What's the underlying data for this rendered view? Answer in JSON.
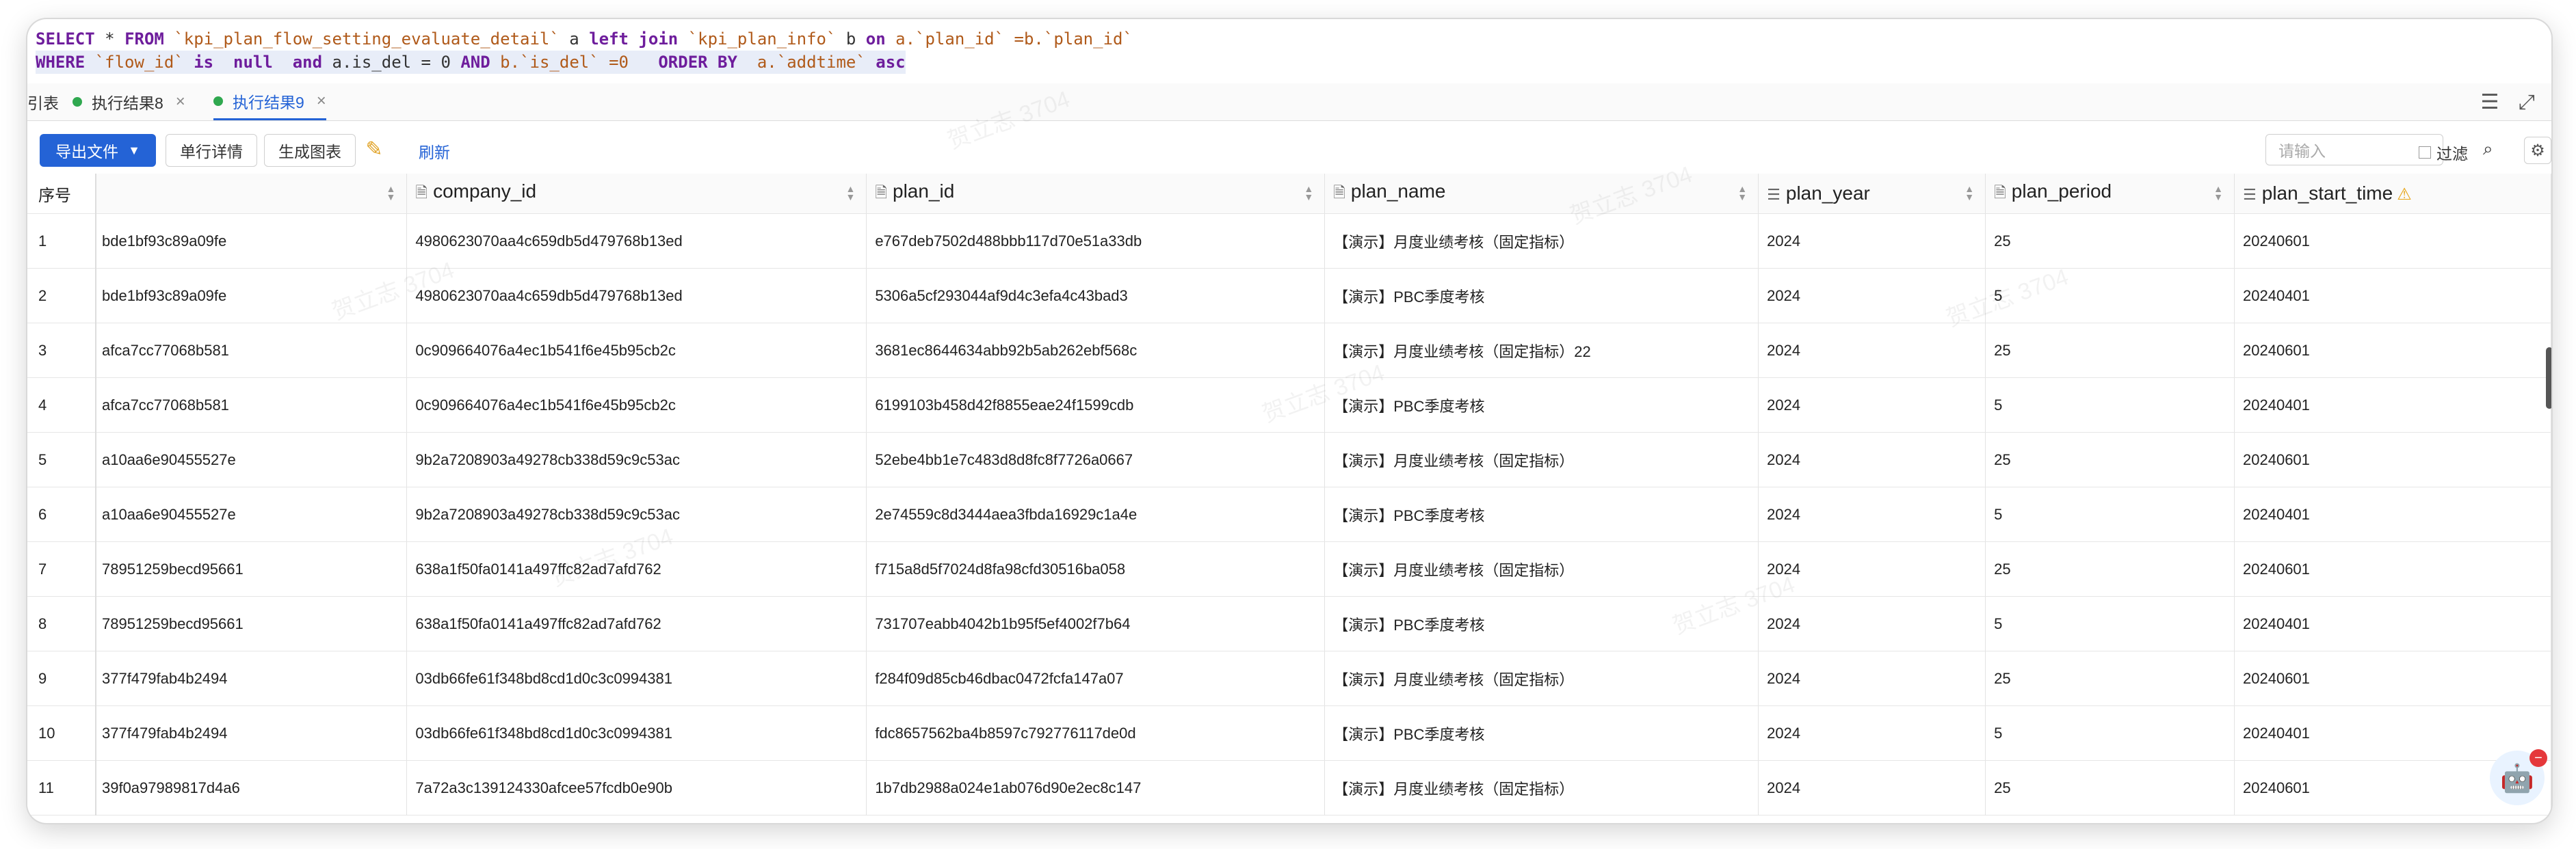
{
  "sql": {
    "line1": {
      "select": "SELECT",
      "star": " * ",
      "from": "FROM",
      "table_a": " `kpi_plan_flow_setting_evaluate_detail` ",
      "alias_a": "a ",
      "left_join": "left join",
      "table_b": " `kpi_plan_info` ",
      "alias_b": "b ",
      "on": "on",
      "cond": " a.`plan_id` =b.`plan_id`"
    },
    "line2": {
      "where": "WHERE",
      "cond1": " `flow_id` ",
      "is": "is",
      "null": "  null  ",
      "and": "and",
      "cond2": " a.is_del = 0 ",
      "and2": "AND",
      "cond3": " b.`is_del` =0   ",
      "order_by": "ORDER BY",
      "cond4": "  a.`addtime` ",
      "asc": "asc"
    }
  },
  "tabs": {
    "left_cut": "引表",
    "items": [
      {
        "label": "执行结果8",
        "active": false
      },
      {
        "label": "执行结果9",
        "active": true
      }
    ]
  },
  "toolbar": {
    "export_label": "导出文件",
    "single_row_label": "单行详情",
    "chart_label": "生成图表",
    "refresh_label": "刷新",
    "search_placeholder": "请输入",
    "filter_label": "过滤"
  },
  "table": {
    "seq_header": "序号",
    "columns": [
      {
        "name": "",
        "icon": ""
      },
      {
        "name": "company_id",
        "icon": "doc"
      },
      {
        "name": "plan_id",
        "icon": "doc"
      },
      {
        "name": "plan_name",
        "icon": "doc"
      },
      {
        "name": "plan_year",
        "icon": "list"
      },
      {
        "name": "plan_period",
        "icon": "doc"
      },
      {
        "name": "plan_start_time",
        "icon": "list",
        "warn": true
      }
    ],
    "rows": [
      {
        "seq": "1",
        "c0": "bde1bf93c89a09fe",
        "company_id": "4980623070aa4c659db5d479768b13ed",
        "plan_id": "e767deb7502d488bbb117d70e51a33db",
        "plan_name": "【演示】月度业绩考核（固定指标）",
        "plan_year": "2024",
        "plan_period": "25",
        "plan_start_time": "20240601"
      },
      {
        "seq": "2",
        "c0": "bde1bf93c89a09fe",
        "company_id": "4980623070aa4c659db5d479768b13ed",
        "plan_id": "5306a5cf293044af9d4c3efa4c43bad3",
        "plan_name": "【演示】PBC季度考核",
        "plan_year": "2024",
        "plan_period": "5",
        "plan_start_time": "20240401"
      },
      {
        "seq": "3",
        "c0": "afca7cc77068b581",
        "company_id": "0c909664076a4ec1b541f6e45b95cb2c",
        "plan_id": "3681ec8644634abb92b5ab262ebf568c",
        "plan_name": "【演示】月度业绩考核（固定指标）22",
        "plan_year": "2024",
        "plan_period": "25",
        "plan_start_time": "20240601"
      },
      {
        "seq": "4",
        "c0": "afca7cc77068b581",
        "company_id": "0c909664076a4ec1b541f6e45b95cb2c",
        "plan_id": "6199103b458d42f8855eae24f1599cdb",
        "plan_name": "【演示】PBC季度考核",
        "plan_year": "2024",
        "plan_period": "5",
        "plan_start_time": "20240401"
      },
      {
        "seq": "5",
        "c0": "a10aa6e90455527e",
        "company_id": "9b2a7208903a49278cb338d59c9c53ac",
        "plan_id": "52ebe4bb1e7c483d8d8fc8f7726a0667",
        "plan_name": "【演示】月度业绩考核（固定指标）",
        "plan_year": "2024",
        "plan_period": "25",
        "plan_start_time": "20240601"
      },
      {
        "seq": "6",
        "c0": "a10aa6e90455527e",
        "company_id": "9b2a7208903a49278cb338d59c9c53ac",
        "plan_id": "2e74559c8d3444aea3fbda16929c1a4e",
        "plan_name": "【演示】PBC季度考核",
        "plan_year": "2024",
        "plan_period": "5",
        "plan_start_time": "20240401"
      },
      {
        "seq": "7",
        "c0": "78951259becd95661",
        "company_id": "638a1f50fa0141a497ffc82ad7afd762",
        "plan_id": "f715a8d5f7024d8fa98cfd30516ba058",
        "plan_name": "【演示】月度业绩考核（固定指标）",
        "plan_year": "2024",
        "plan_period": "25",
        "plan_start_time": "20240601"
      },
      {
        "seq": "8",
        "c0": "78951259becd95661",
        "company_id": "638a1f50fa0141a497ffc82ad7afd762",
        "plan_id": "731707eabb4042b1b95f5ef4002f7b64",
        "plan_name": "【演示】PBC季度考核",
        "plan_year": "2024",
        "plan_period": "5",
        "plan_start_time": "20240401"
      },
      {
        "seq": "9",
        "c0": "377f479fab4b2494",
        "company_id": "03db66fe61f348bd8cd1d0c3c0994381",
        "plan_id": "f284f09d85cb46dbac0472fcfa147a07",
        "plan_name": "【演示】月度业绩考核（固定指标）",
        "plan_year": "2024",
        "plan_period": "25",
        "plan_start_time": "20240601"
      },
      {
        "seq": "10",
        "c0": "377f479fab4b2494",
        "company_id": "03db66fe61f348bd8cd1d0c3c0994381",
        "plan_id": "fdc8657562ba4b8597c792776117de0d",
        "plan_name": "【演示】PBC季度考核",
        "plan_year": "2024",
        "plan_period": "5",
        "plan_start_time": "20240401"
      },
      {
        "seq": "11",
        "c0": "39f0a97989817d4a6",
        "company_id": "7a72a3c139124330afcee57fcdb0e90b",
        "plan_id": "1b7db2988a024e1ab076d90e2ec8c147",
        "plan_name": "【演示】月度业绩考核（固定指标）",
        "plan_year": "2024",
        "plan_period": "25",
        "plan_start_time": "20240601"
      }
    ]
  },
  "watermark_text": "贺立志 3704",
  "colors": {
    "accent": "#2463d6",
    "keyword": "#6e1d9c",
    "string": "#b05a1a",
    "status_ok": "#2fa84f",
    "warning": "#e6a417"
  },
  "icons": {
    "list": "list-icon",
    "doc": "document-icon",
    "menu": "hamburger-menu-icon",
    "expand": "expand-icon",
    "search": "search-icon",
    "gear": "gear-icon",
    "pen": "edit-pen-icon",
    "assistant": "assistant-avatar-icon"
  }
}
